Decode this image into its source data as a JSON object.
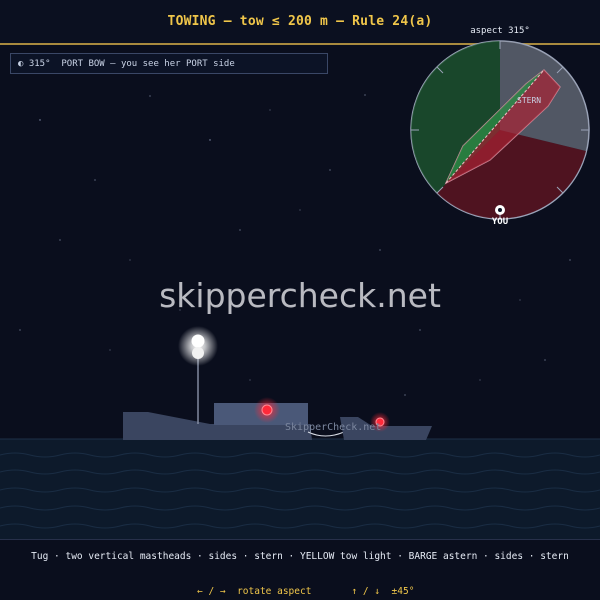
{
  "title": "TOWING — tow ≤ 200 m — Rule 24(a)",
  "aspect_panel": {
    "icon": "half-circle-icon",
    "icon_glyph": "◐",
    "text": "315°  PORT BOW — you see her PORT side"
  },
  "compass": {
    "label": "aspect 315°",
    "stern_label": "STERN",
    "you_label": "YOU"
  },
  "watermark": "skippercheck.net",
  "scene_watermark": "SkipperCheck.net",
  "legend": "Tug · two vertical mastheads · sides · stern · YELLOW tow light · BARGE astern · sides · stern",
  "controls": {
    "rotate_keys": "← / →",
    "rotate_label": "rotate aspect",
    "step_keys": "↑ / ↓",
    "step_label": "±45°"
  },
  "colors": {
    "title": "#f0c64a",
    "title_rule": "#a88a3e",
    "sky": "#0a0e1d",
    "sea": "#0d1a2b",
    "hull": "#3a4560",
    "port_light": "#ff2a3a",
    "masthead_light": "#ffffff",
    "starboard_sector": "#1f6f35",
    "port_sector": "#7a1622"
  }
}
